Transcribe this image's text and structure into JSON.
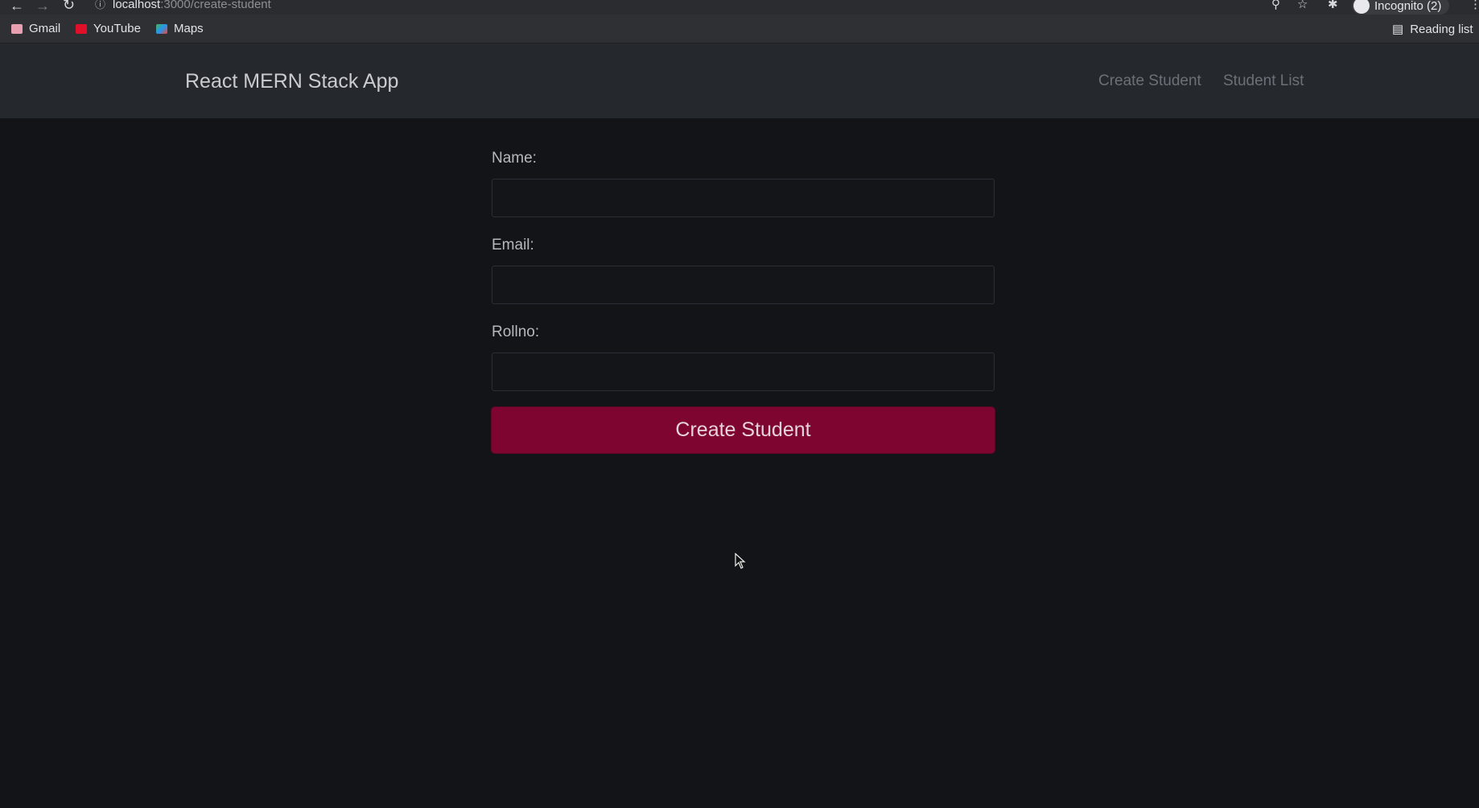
{
  "browser": {
    "url_host": "localhost",
    "url_path": ":3000/create-student",
    "bookmarks": [
      {
        "label": "Gmail",
        "icon": "gmail-icon",
        "color": "#e8a0b0"
      },
      {
        "label": "YouTube",
        "icon": "youtube-icon",
        "color": "#e0102a"
      },
      {
        "label": "Maps",
        "icon": "maps-icon",
        "color": "#4caf50"
      }
    ],
    "profile_label": "Incognito (2)",
    "reading_list_label": "Reading list"
  },
  "navbar": {
    "brand": "React MERN Stack App",
    "links": [
      {
        "label": "Create Student"
      },
      {
        "label": "Student List"
      }
    ]
  },
  "form": {
    "fields": [
      {
        "label": "Name:",
        "value": ""
      },
      {
        "label": "Email:",
        "value": ""
      },
      {
        "label": "Rollno:",
        "value": ""
      }
    ],
    "submit_label": "Create Student"
  },
  "colors": {
    "accent": "#7e0530",
    "navbar_bg": "#25282d",
    "page_bg": "#131418"
  }
}
